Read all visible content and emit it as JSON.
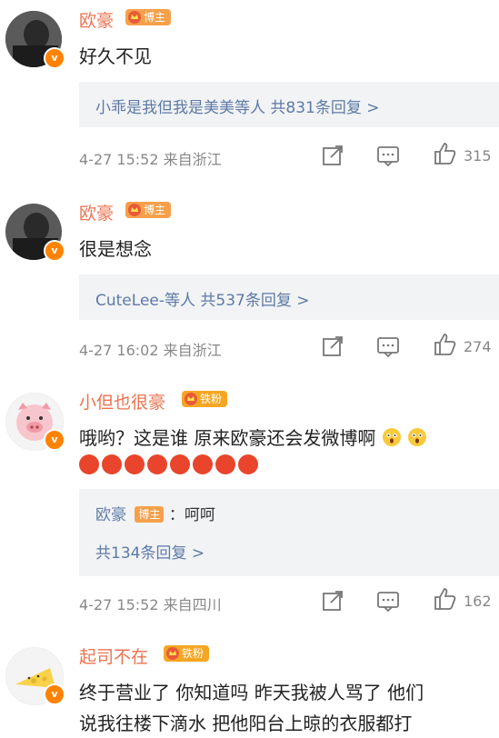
{
  "comments": [
    {
      "author": "欧豪",
      "badge": "博主",
      "text": "好久不见",
      "reply_summary": "小乖是我但我是美美等人  共831条回复 >",
      "time_location": "4-27 15:52 来自浙江",
      "likes": "315"
    },
    {
      "author": "欧豪",
      "badge": "博主",
      "text": "很是想念",
      "reply_summary": "CuteLee-等人  共537条回复 >",
      "time_location": "4-27 16:02 来自浙江",
      "likes": "274"
    },
    {
      "author": "小但也很豪",
      "badge": "铁粉",
      "text": "哦哟？这是谁 原来欧豪还会发微博啊",
      "reply_author": "欧豪",
      "reply_badge": "博主",
      "reply_text": "：呵呵",
      "reply_summary": "共134条回复 >",
      "time_location": "4-27 15:52 来自四川",
      "likes": "162"
    },
    {
      "author": "起司不在",
      "badge": "铁粉",
      "text_line1": "终于营业了 你知道吗 昨天我被人骂了 他们",
      "text_line2": "说我往楼下滴水 把他阳台上晾的衣服都打"
    }
  ],
  "colors": {
    "author": "#eb7350",
    "link": "#5d7aa6",
    "meta": "#888888",
    "reply_bg": "#f2f3f5",
    "verified": "#ff8200"
  }
}
